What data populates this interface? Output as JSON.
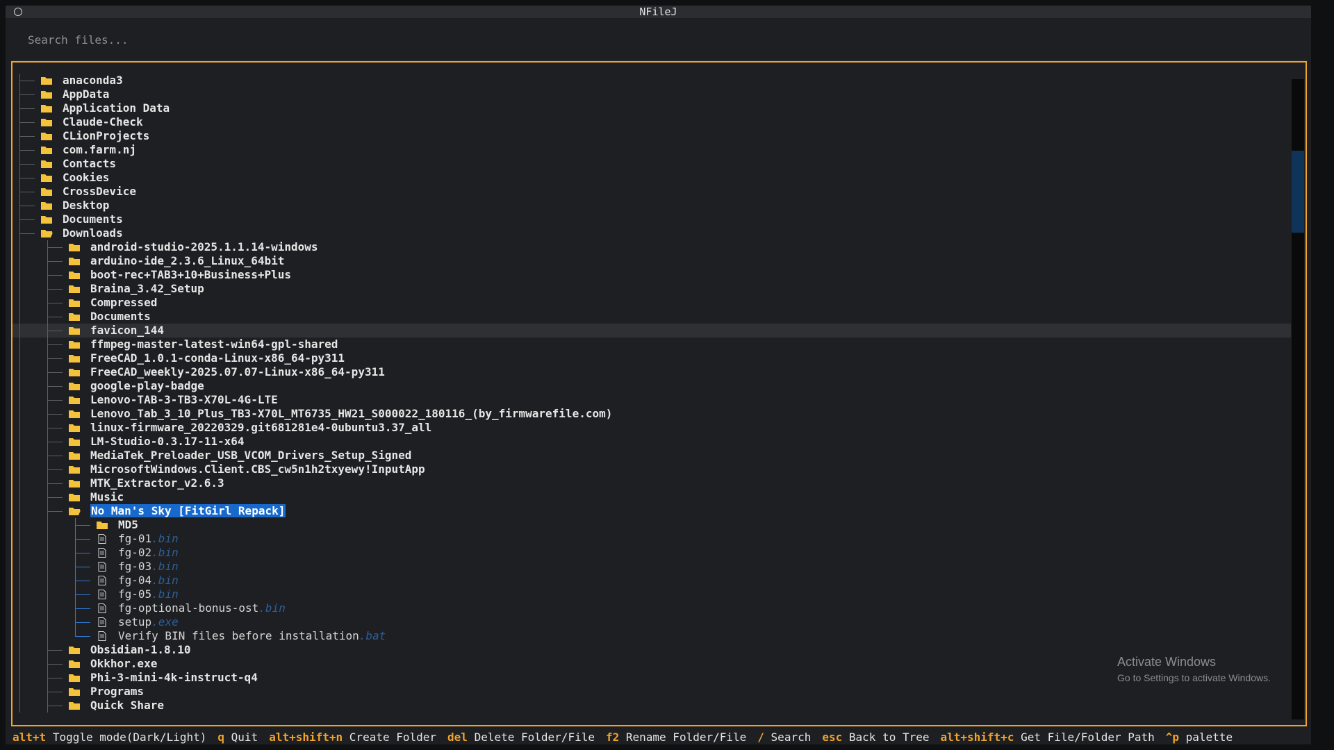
{
  "window": {
    "title": "NFileJ"
  },
  "search": {
    "placeholder": "Search files..."
  },
  "tree": {
    "rows": [
      {
        "label": "anaconda3",
        "type": "folder",
        "depth": 0
      },
      {
        "label": "AppData",
        "type": "folder",
        "depth": 0
      },
      {
        "label": "Application Data",
        "type": "folder",
        "depth": 0
      },
      {
        "label": "Claude-Check",
        "type": "folder",
        "depth": 0
      },
      {
        "label": "CLionProjects",
        "type": "folder",
        "depth": 0
      },
      {
        "label": "com.farm.nj",
        "type": "folder",
        "depth": 0
      },
      {
        "label": "Contacts",
        "type": "folder",
        "depth": 0
      },
      {
        "label": "Cookies",
        "type": "folder",
        "depth": 0
      },
      {
        "label": "CrossDevice",
        "type": "folder",
        "depth": 0
      },
      {
        "label": "Desktop",
        "type": "folder",
        "depth": 0
      },
      {
        "label": "Documents",
        "type": "folder",
        "depth": 0
      },
      {
        "label": "Downloads",
        "type": "folder",
        "depth": 0,
        "open": true
      },
      {
        "label": "android-studio-2025.1.1.14-windows",
        "type": "folder",
        "depth": 1
      },
      {
        "label": "arduino-ide_2.3.6_Linux_64bit",
        "type": "folder",
        "depth": 1
      },
      {
        "label": "boot-rec+TAB3+10+Business+Plus",
        "type": "folder",
        "depth": 1
      },
      {
        "label": "Braina_3.42_Setup",
        "type": "folder",
        "depth": 1
      },
      {
        "label": "Compressed",
        "type": "folder",
        "depth": 1
      },
      {
        "label": "Documents",
        "type": "folder",
        "depth": 1
      },
      {
        "label": "favicon_144",
        "type": "folder",
        "depth": 1,
        "hover": true
      },
      {
        "label": "ffmpeg-master-latest-win64-gpl-shared",
        "type": "folder",
        "depth": 1
      },
      {
        "label": "FreeCAD_1.0.1-conda-Linux-x86_64-py311",
        "type": "folder",
        "depth": 1
      },
      {
        "label": "FreeCAD_weekly-2025.07.07-Linux-x86_64-py311",
        "type": "folder",
        "depth": 1
      },
      {
        "label": "google-play-badge",
        "type": "folder",
        "depth": 1
      },
      {
        "label": "Lenovo-TAB-3-TB3-X70L-4G-LTE",
        "type": "folder",
        "depth": 1
      },
      {
        "label": "Lenovo_Tab_3_10_Plus_TB3-X70L_MT6735_HW21_S000022_180116_(by_firmwarefile.com)",
        "type": "folder",
        "depth": 1
      },
      {
        "label": "linux-firmware_20220329.git681281e4-0ubuntu3.37_all",
        "type": "folder",
        "depth": 1
      },
      {
        "label": "LM-Studio-0.3.17-11-x64",
        "type": "folder",
        "depth": 1
      },
      {
        "label": "MediaTek_Preloader_USB_VCOM_Drivers_Setup_Signed",
        "type": "folder",
        "depth": 1
      },
      {
        "label": "MicrosoftWindows.Client.CBS_cw5n1h2txyewy!InputApp",
        "type": "folder",
        "depth": 1
      },
      {
        "label": "MTK_Extractor_v2.6.3",
        "type": "folder",
        "depth": 1
      },
      {
        "label": "Music",
        "type": "folder",
        "depth": 1
      },
      {
        "label": "No Man's Sky [FitGirl Repack]",
        "type": "folder",
        "depth": 1,
        "open": true,
        "selected": true
      },
      {
        "label": "MD5",
        "type": "folder",
        "depth": 2
      },
      {
        "label": "fg-01",
        "ext": ".bin",
        "type": "file",
        "depth": 2
      },
      {
        "label": "fg-02",
        "ext": ".bin",
        "type": "file",
        "depth": 2
      },
      {
        "label": "fg-03",
        "ext": ".bin",
        "type": "file",
        "depth": 2
      },
      {
        "label": "fg-04",
        "ext": ".bin",
        "type": "file",
        "depth": 2
      },
      {
        "label": "fg-05",
        "ext": ".bin",
        "type": "file",
        "depth": 2
      },
      {
        "label": "fg-optional-bonus-ost",
        "ext": ".bin",
        "type": "file",
        "depth": 2
      },
      {
        "label": "setup",
        "ext": ".exe",
        "type": "file",
        "depth": 2
      },
      {
        "label": "Verify BIN files before installation",
        "ext": ".bat",
        "type": "file",
        "depth": 2
      },
      {
        "label": "Obsidian-1.8.10",
        "type": "folder",
        "depth": 1
      },
      {
        "label": "Okkhor.exe",
        "type": "folder",
        "depth": 1
      },
      {
        "label": "Phi-3-mini-4k-instruct-q4",
        "type": "folder",
        "depth": 1
      },
      {
        "label": "Programs",
        "type": "folder",
        "depth": 1
      },
      {
        "label": "Quick Share",
        "type": "folder",
        "depth": 1
      }
    ]
  },
  "watermark": {
    "line1": "Activate Windows",
    "line2": "Go to Settings to activate Windows."
  },
  "footer": {
    "hints": [
      {
        "key": "alt+t",
        "text": "Toggle mode(Dark/Light)"
      },
      {
        "key": "q",
        "text": "Quit"
      },
      {
        "key": "alt+shift+n",
        "text": "Create Folder"
      },
      {
        "key": "del",
        "text": "Delete Folder/File"
      },
      {
        "key": "f2",
        "text": "Rename Folder/File"
      },
      {
        "key": "/",
        "text": "Search"
      },
      {
        "key": "esc",
        "text": "Back to Tree"
      },
      {
        "key": "alt+shift+c",
        "text": "Get File/Folder Path"
      },
      {
        "key": "^p",
        "text": "palette"
      }
    ]
  },
  "colors": {
    "accent": "#f0a42a",
    "selection": "#1769cd",
    "folder": "#f5c33b",
    "extension": "#2d5f98"
  }
}
